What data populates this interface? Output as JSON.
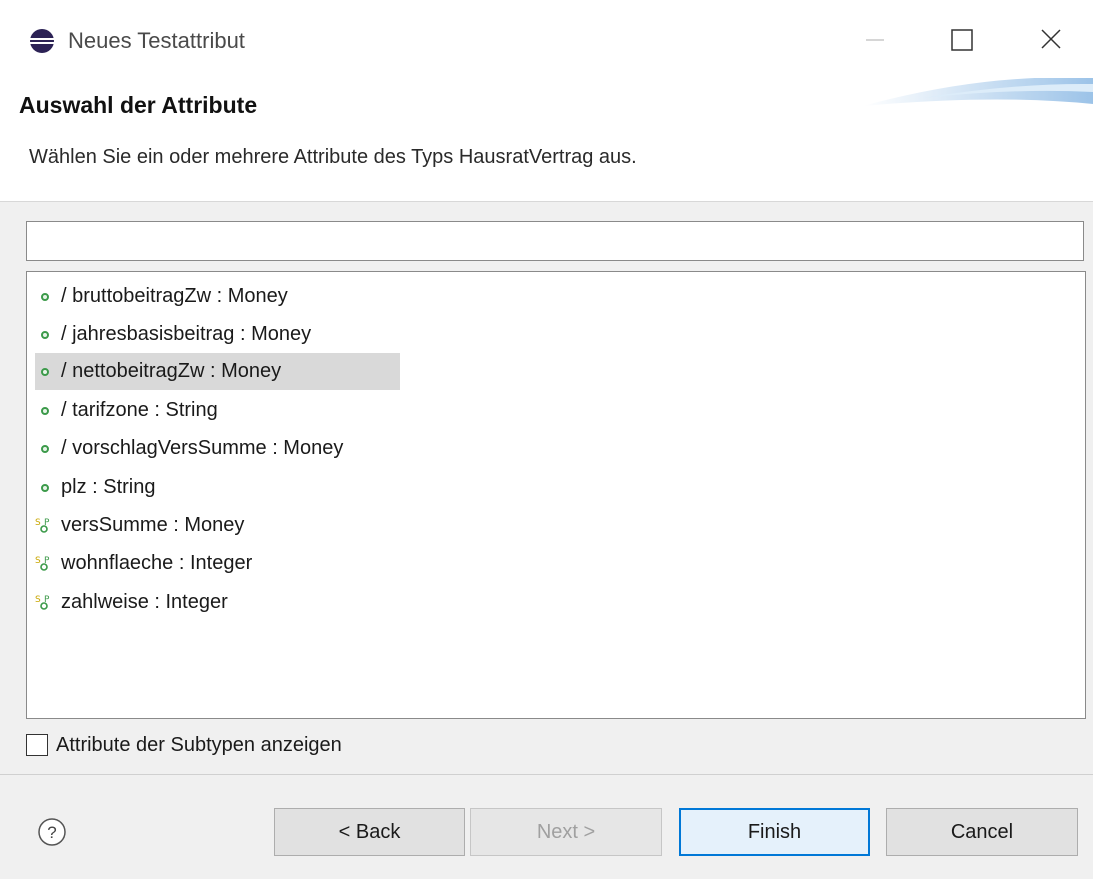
{
  "window": {
    "title": "Neues Testattribut"
  },
  "header": {
    "title": "Auswahl der Attribute",
    "description": "Wählen Sie ein oder mehrere Attribute des Typs HausratVertrag aus."
  },
  "filter": {
    "value": "",
    "placeholder": ""
  },
  "attributes": {
    "items": [
      {
        "label": "/ bruttobeitragZw : Money",
        "icon": "derived-attribute-icon",
        "selected": false
      },
      {
        "label": "/ jahresbasisbeitrag : Money",
        "icon": "derived-attribute-icon",
        "selected": false
      },
      {
        "label": "/ nettobeitragZw : Money",
        "icon": "derived-attribute-icon",
        "selected": true
      },
      {
        "label": "/ tarifzone : String",
        "icon": "derived-attribute-icon",
        "selected": false
      },
      {
        "label": "/ vorschlagVersSumme : Money",
        "icon": "derived-attribute-icon",
        "selected": false
      },
      {
        "label": "plz : String",
        "icon": "derived-attribute-icon",
        "selected": false
      },
      {
        "label": "versSumme : Money",
        "icon": "changeable-attribute-icon",
        "selected": false
      },
      {
        "label": "wohnflaeche : Integer",
        "icon": "changeable-attribute-icon",
        "selected": false
      },
      {
        "label": "zahlweise : Integer",
        "icon": "changeable-attribute-icon",
        "selected": false
      }
    ]
  },
  "options": {
    "show_subtypes_label": "Attribute der Subtypen anzeigen",
    "show_subtypes_checked": false
  },
  "footer": {
    "help_label": "?",
    "back_label": "< Back",
    "next_label": "Next >",
    "finish_label": "Finish",
    "cancel_label": "Cancel"
  },
  "colors": {
    "accent": "#0078d7",
    "attribute_icon": "#3c9a4a"
  }
}
